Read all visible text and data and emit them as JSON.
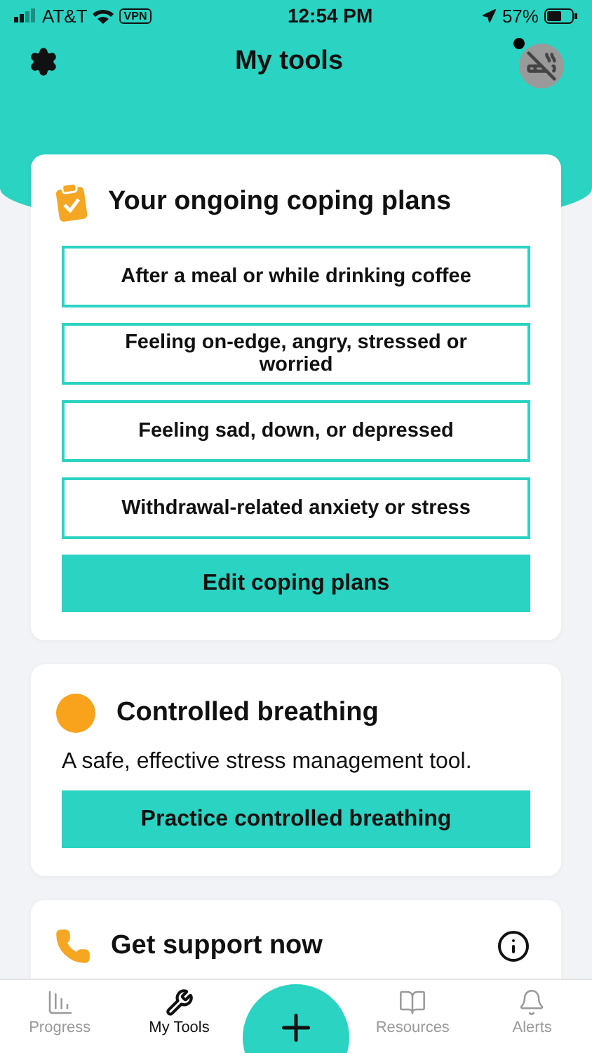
{
  "status_bar": {
    "carrier": "AT&T",
    "vpn": "VPN",
    "time": "12:54 PM",
    "battery": "57%"
  },
  "header": {
    "title": "My tools",
    "notification_dot": true
  },
  "coping_plans": {
    "title": "Your ongoing coping plans",
    "plans": [
      "After a meal or while drinking coffee",
      "Feeling on-edge, angry, stressed or worried",
      "Feeling sad, down, or depressed",
      "Withdrawal-related anxiety or stress"
    ],
    "button": "Edit coping plans"
  },
  "breathing": {
    "title": "Controlled breathing",
    "description": "A safe, effective stress management tool.",
    "button": "Practice controlled breathing"
  },
  "support": {
    "title": "Get support now"
  },
  "tab_bar": [
    {
      "label": "Progress",
      "selected": false
    },
    {
      "label": "My Tools",
      "selected": true
    },
    {
      "kind": "add"
    },
    {
      "label": "Resources",
      "selected": false
    },
    {
      "label": "Alerts",
      "selected": false
    }
  ]
}
